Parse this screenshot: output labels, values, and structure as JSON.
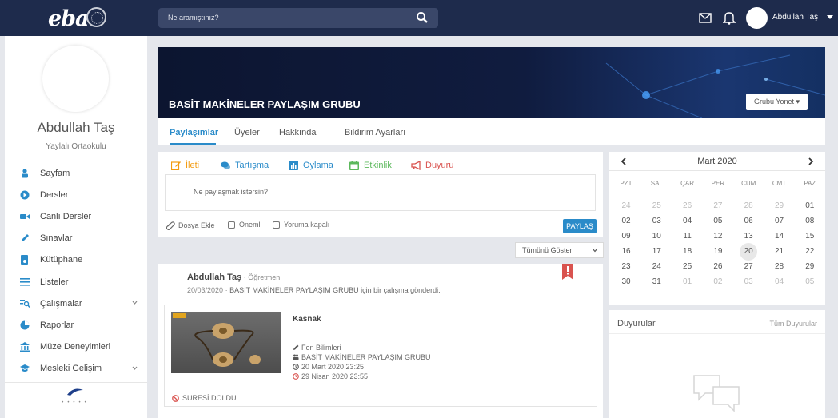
{
  "topbar": {
    "logo": "eba",
    "search_placeholder": "Ne aramıştınız?",
    "user_name": "Abdullah Taş"
  },
  "sidebar": {
    "name": "Abdullah Taş",
    "school": "Yaylalı Ortaokulu",
    "items": [
      {
        "label": "Sayfam",
        "icon": "user-icon",
        "color": "#2a8bc9"
      },
      {
        "label": "Dersler",
        "icon": "play-icon",
        "color": "#2a8bc9"
      },
      {
        "label": "Canlı Dersler",
        "icon": "video-icon",
        "color": "#2a8bc9"
      },
      {
        "label": "Sınavlar",
        "icon": "pencil-icon",
        "color": "#2a8bc9"
      },
      {
        "label": "Kütüphane",
        "icon": "library-icon",
        "color": "#2a8bc9"
      },
      {
        "label": "Listeler",
        "icon": "list-icon",
        "color": "#2a8bc9"
      },
      {
        "label": "Çalışmalar",
        "icon": "search-doc-icon",
        "color": "#2a8bc9"
      },
      {
        "label": "Raporlar",
        "icon": "pie-icon",
        "color": "#2a8bc9"
      },
      {
        "label": "Müze Deneyimleri",
        "icon": "museum-icon",
        "color": "#2a8bc9"
      },
      {
        "label": "Mesleki Gelişim",
        "icon": "graduation-icon",
        "color": "#2a8bc9"
      }
    ]
  },
  "group": {
    "title": "BASİT MAKİNELER PAYLAŞIM GRUBU",
    "manage_label": "Grubu Yonet ▾",
    "tabs": [
      "Paylaşımlar",
      "Üyeler",
      "Hakkında",
      "Bildirim Ayarları"
    ]
  },
  "composer": {
    "types": [
      {
        "label": "İleti",
        "color": "#f39c12",
        "icon": "edit-icon"
      },
      {
        "label": "Tartışma",
        "color": "#2a8bc9",
        "icon": "chat-bubbles-icon"
      },
      {
        "label": "Oylama",
        "color": "#2a8bc9",
        "icon": "poll-icon"
      },
      {
        "label": "Etkinlik",
        "color": "#5cb85c",
        "icon": "calendar-icon"
      },
      {
        "label": "Duyuru",
        "color": "#d9534f",
        "icon": "megaphone-icon"
      }
    ],
    "placeholder": "Ne paylaşmak istersin?",
    "attach_label": "Dosya Ekle",
    "important_label": "Önemli",
    "comments_closed_label": "Yoruma kapalı",
    "share_label": "PAYLAŞ"
  },
  "filter": {
    "selected": "Tümünü Göster"
  },
  "post": {
    "author": "Abdullah Taş",
    "role": " · Öğretmen",
    "date": "20/03/2020",
    "description": "BASİT MAKİNELER PAYLAŞIM GRUBU için bir çalışma gönderdi.",
    "card": {
      "title": "Kasnak",
      "subject": "Fen Bilimleri",
      "group": "BASİT MAKİNELER PAYLAŞIM GRUBU",
      "start": "20 Mart 2020 23:25",
      "end": "29 Nisan 2020 23:55",
      "status": "SURESİ DOLDU"
    }
  },
  "calendar": {
    "month": "Mart 2020",
    "days_of_week": [
      "PZT",
      "SAL",
      "ÇAR",
      "PER",
      "CUM",
      "CMT",
      "PAZ"
    ],
    "weeks": [
      [
        "24",
        "25",
        "26",
        "27",
        "28",
        "29",
        "01"
      ],
      [
        "02",
        "03",
        "04",
        "05",
        "06",
        "07",
        "08"
      ],
      [
        "09",
        "10",
        "11",
        "12",
        "13",
        "14",
        "15"
      ],
      [
        "16",
        "17",
        "18",
        "19",
        "20",
        "21",
        "22"
      ],
      [
        "23",
        "24",
        "25",
        "26",
        "27",
        "28",
        "29"
      ],
      [
        "30",
        "31",
        "01",
        "02",
        "03",
        "04",
        "05"
      ]
    ],
    "today": "20"
  },
  "announcements": {
    "title": "Duyurular",
    "all_label": "Tüm Duyurular"
  }
}
